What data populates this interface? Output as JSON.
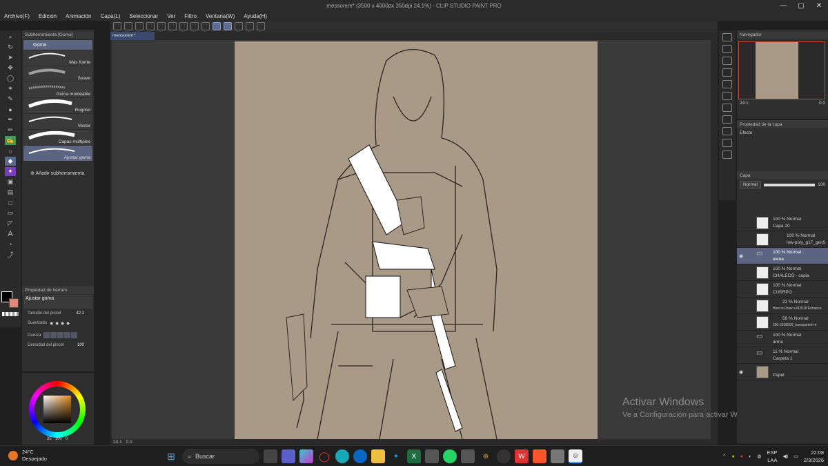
{
  "window": {
    "title": "messorem* (3500 x 4000px 350dpi 24.1%) - CLIP STUDIO PAINT PRO",
    "controls": [
      "—",
      "▢",
      "✕"
    ]
  },
  "menu": [
    "Archivo(F)",
    "Edición",
    "Animación",
    "Capa(L)",
    "Seleccionar",
    "Ver",
    "Filtro",
    "Ventana(W)",
    "Ayuda(H)"
  ],
  "document_tab": "messorem*",
  "subtool_panel": {
    "header": "Subherramienta [Goma]",
    "group": "Goma",
    "items": [
      {
        "label": "Más fuerte"
      },
      {
        "label": "Suave"
      },
      {
        "label": "Goma moldeable"
      },
      {
        "label": "Rugoso"
      },
      {
        "label": "Vector"
      },
      {
        "label": "Capas múltiples"
      },
      {
        "label": "Ajustar goma"
      }
    ],
    "add_label": "Añadir subherramienta"
  },
  "tool_property": {
    "header": "Propiedad de herram",
    "tool_name": "Ajustar goma",
    "brush_size_label": "Tamaño del pincel",
    "brush_size_value": "42.1",
    "smoothing_label": "Suavizado",
    "hardness_label": "Dureza",
    "density_label": "Densidad del pincel",
    "density_value": "100"
  },
  "color_panel": {
    "readout": "35   100   0"
  },
  "canvas": {
    "zoom": "24.1",
    "rotation": "0.0"
  },
  "navigator": {
    "header": "Navegador",
    "zoom": "24.1",
    "rotation": "0.0"
  },
  "layer_property": {
    "header": "Propiedad de la capa",
    "effect_label": "Efecto"
  },
  "layer_panel": {
    "header": "Capa",
    "blend_mode": "Normal",
    "opacity": "100",
    "layers": [
      {
        "line1": "100 % Normal",
        "line2": "Capa 20",
        "type": "raster",
        "visible": false,
        "selected": false
      },
      {
        "line1": "100 % Normal",
        "line2": "low-poly_g17_gen5",
        "type": "3d",
        "visible": false,
        "selected": false
      },
      {
        "line1": "100 % Normal",
        "line2": "elena",
        "type": "folder",
        "visible": true,
        "selected": true
      },
      {
        "line1": "100 % Normal",
        "line2": "CHALECO - copia",
        "type": "raster",
        "visible": false,
        "selected": false
      },
      {
        "line1": "100 % Normal",
        "line2": "CUERPO",
        "type": "raster",
        "visible": false,
        "selected": false
      },
      {
        "line1": "22 % Normal",
        "line2": "How to Draw a M2018 Enhance",
        "type": "image",
        "visible": false,
        "selected": false
      },
      {
        "line1": "58 % Normal",
        "line2": "250-2508509_transparent-m",
        "type": "image",
        "visible": false,
        "selected": false
      },
      {
        "line1": "100 % Normal",
        "line2": "arma",
        "type": "folder",
        "visible": false,
        "selected": false
      },
      {
        "line1": "11 % Normal",
        "line2": "Carpeta 1",
        "type": "folder",
        "visible": false,
        "selected": false
      },
      {
        "line1": "",
        "line2": "Papel",
        "type": "paper",
        "visible": true,
        "selected": false
      }
    ]
  },
  "watermark": {
    "line1": "Activar Windows",
    "line2": "Ve a Configuración para activar Windows."
  },
  "taskbar": {
    "weather_temp": "24°C",
    "weather_desc": "Despejado",
    "search_placeholder": "Buscar",
    "lang_line1": "ESP",
    "lang_line2": "LAA",
    "time": "22:08",
    "date": "2/3/2026"
  },
  "colors": {
    "paper": "#a89a86",
    "selected": "#5b6581",
    "accent_red": "#c43c3c"
  }
}
